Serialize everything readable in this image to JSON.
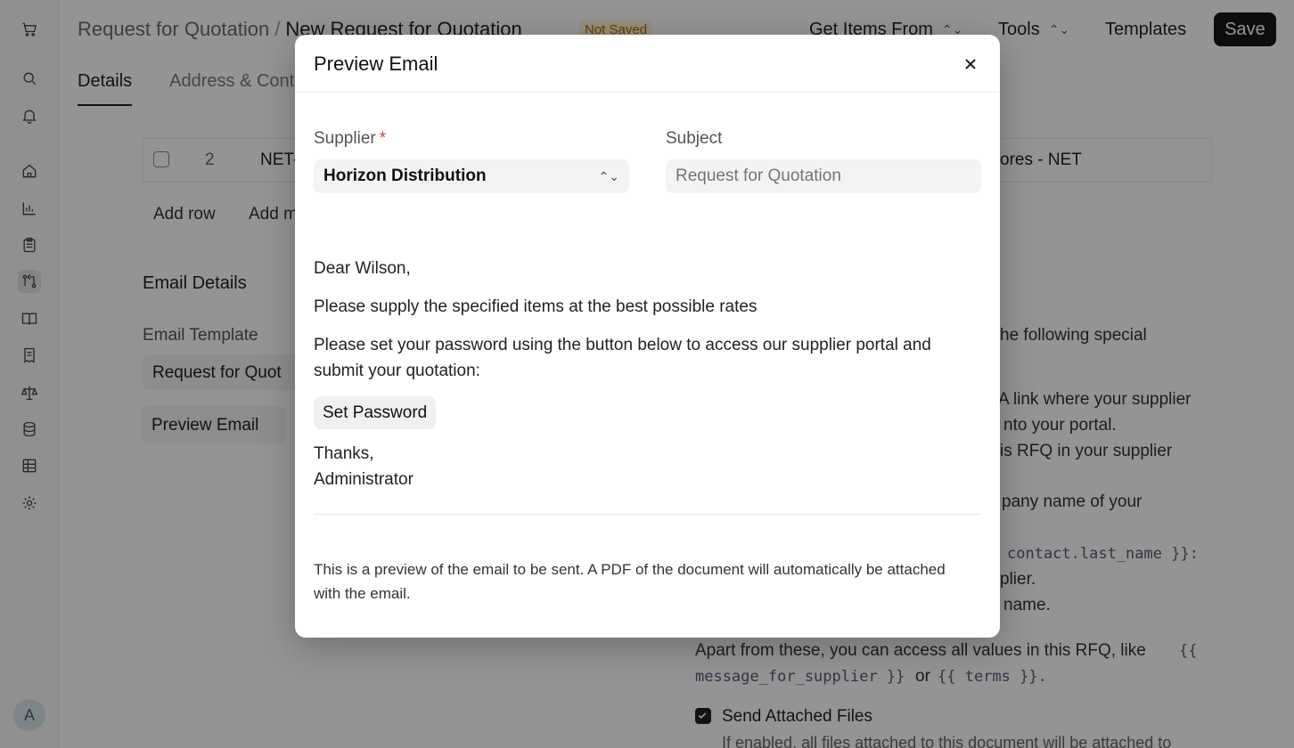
{
  "header": {
    "breadcrumb_parent": "Request for Quotation",
    "breadcrumb_sep": "/",
    "breadcrumb_current": "New Request for Quotation",
    "status_badge": "Not Saved",
    "get_items_label": "Get Items From",
    "tools_label": "Tools",
    "templates_label": "Templates",
    "save_label": "Save"
  },
  "sidebar": {
    "icons": [
      "cart-icon",
      "search-icon",
      "bell-icon",
      "home-icon",
      "chart-icon",
      "clipboard-icon",
      "git-compare-icon",
      "book-icon",
      "receipt-icon",
      "scale-icon",
      "database-icon",
      "table-icon",
      "gear-icon"
    ],
    "avatar_initial": "A"
  },
  "tabs": [
    {
      "label": "Details"
    },
    {
      "label": "Address & Cont"
    }
  ],
  "background": {
    "row_index": "2",
    "row_code": "NET-",
    "row_warehouse": "ores - NET",
    "add_row": "Add row",
    "add_multi": "Add m",
    "email_details": "Email Details",
    "email_template_label": "Email Template",
    "email_template_value": "Request for Quot",
    "preview_email_button": "Preview Email",
    "help_line1": "he following special",
    "help_line2": "A link where your supplier",
    "help_line3": "nto your portal.",
    "help_line4": "is RFQ in your supplier",
    "help_line5": "pany name of your",
    "help_code1": "contact.last_name }}:",
    "help_line6": "plier.",
    "help_line7": "name.",
    "help_line8": "Apart from these, you can access all values in this RFQ, like",
    "help_code2": "{{",
    "help_code3": "message_for_supplier }}",
    "help_or": "or",
    "help_code4": "{{ terms }}.",
    "send_attached_label": "Send Attached Files",
    "send_attached_hint": "If enabled, all files attached to this document will be attached to"
  },
  "modal": {
    "title": "Preview Email",
    "supplier_label": "Supplier",
    "required_mark": "*",
    "supplier_value": "Horizon Distribution",
    "subject_label": "Subject",
    "subject_placeholder": "Request for Quotation",
    "greeting": "Dear Wilson,",
    "line1": "Please supply the specified items at the best possible rates",
    "line2": "Please set your password using the button below to access our supplier portal and submit your quotation:",
    "set_password_label": "Set Password",
    "thanks": "Thanks,",
    "signature": "Administrator",
    "note": "This is a preview of the email to be sent. A PDF of the document will automatically be attached with the email."
  }
}
